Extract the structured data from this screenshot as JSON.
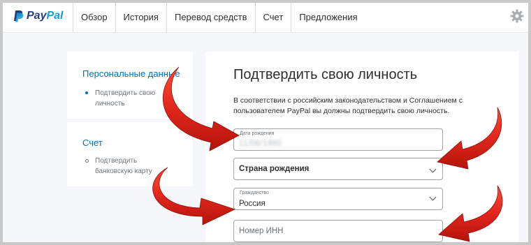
{
  "brand": {
    "name_part1": "Pay",
    "name_part2": "Pal"
  },
  "nav": {
    "items": [
      {
        "label": "Обзор"
      },
      {
        "label": "История"
      },
      {
        "label": "Перевод средств"
      },
      {
        "label": "Счет"
      },
      {
        "label": "Предложения"
      }
    ]
  },
  "sidebar": {
    "sections": [
      {
        "title": "Персональные данные",
        "step": "Подтвердить свою личность"
      },
      {
        "title": "Счет",
        "step": "Подтвердить банковскую карту"
      }
    ]
  },
  "form": {
    "title": "Подтвердить свою личность",
    "intro": "В соответствии с российским законодательством и Соглашением с пользователем PayPal вы должны подтвердить свою личность.",
    "birth_date_label": "Дата рождения",
    "birth_date_value": "11/06/1980",
    "birth_country": "Страна рождения",
    "citizenship_label": "Гражданство",
    "citizenship_value": "Россия",
    "inn_placeholder": "Номер ИНН"
  },
  "colors": {
    "arrow": "#e1261c",
    "link": "#0070ba",
    "brand_dark": "#253b80",
    "brand_light": "#179bd7"
  }
}
